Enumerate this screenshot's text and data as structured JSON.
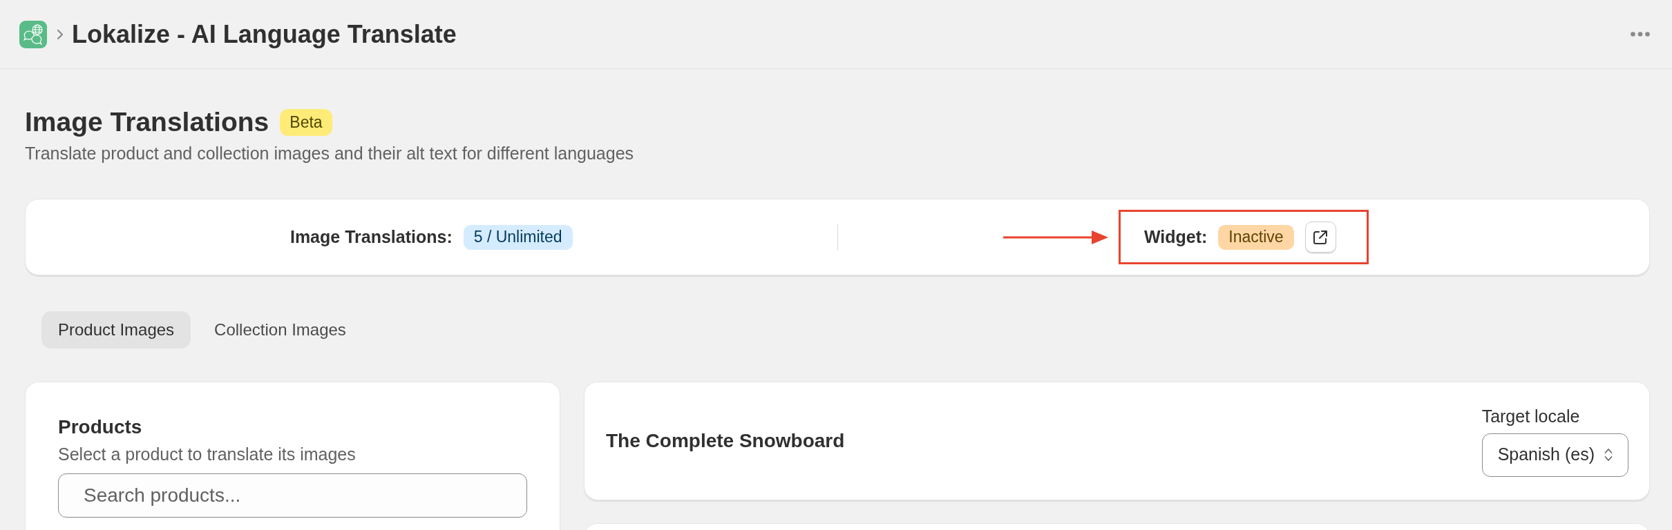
{
  "header": {
    "title": "Lokalize - AI Language Translate"
  },
  "page": {
    "title": "Image Translations",
    "badge": "Beta",
    "subtitle": "Translate product and collection images and their alt text for different languages"
  },
  "usage": {
    "label": "Image Translations:",
    "value": "5 / Unlimited"
  },
  "widget": {
    "label": "Widget:",
    "status": "Inactive",
    "highlighted": true
  },
  "tabs": [
    {
      "label": "Product Images",
      "selected": true
    },
    {
      "label": "Collection Images",
      "selected": false
    }
  ],
  "products_panel": {
    "title": "Products",
    "subtitle": "Select a product to translate its images",
    "search": {
      "placeholder": "Search products..."
    }
  },
  "product_detail": {
    "title": "The Complete Snowboard",
    "locale_label": "Target locale",
    "locale": "Spanish (es)"
  }
}
